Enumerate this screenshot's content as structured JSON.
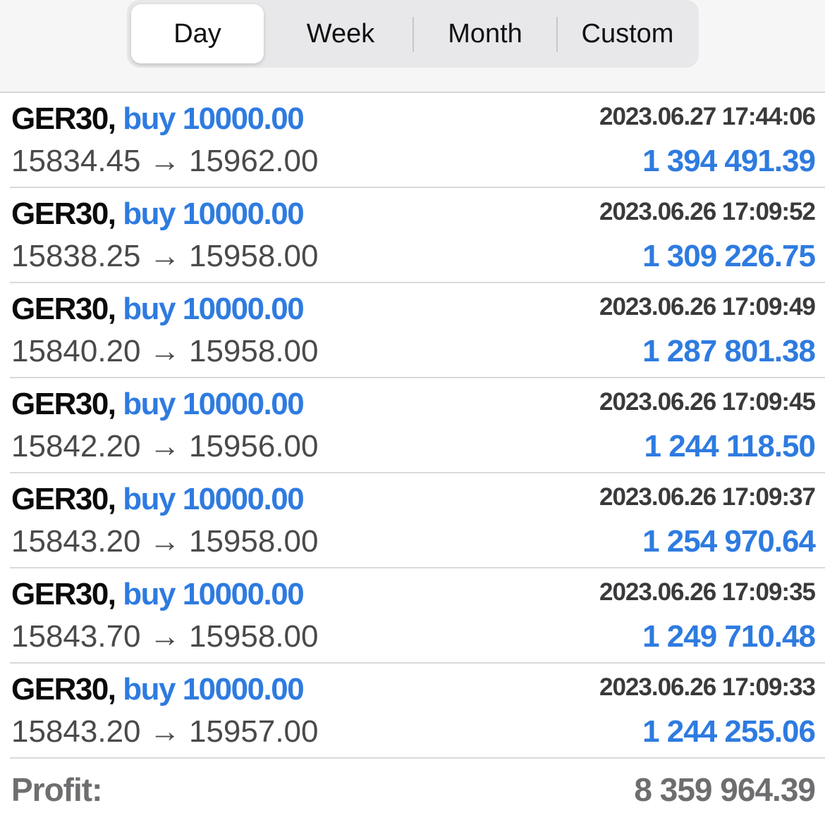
{
  "tabs": [
    {
      "label": "Day",
      "active": true
    },
    {
      "label": "Week",
      "active": false
    },
    {
      "label": "Month",
      "active": false
    },
    {
      "label": "Custom",
      "active": false
    }
  ],
  "deals": [
    {
      "symbol": "GER30,",
      "side": "buy 10000.00",
      "time": "2023.06.27 17:44:06",
      "prices": "15834.45 → 15962.00",
      "profit": "1 394 491.39"
    },
    {
      "symbol": "GER30,",
      "side": "buy 10000.00",
      "time": "2023.06.26 17:09:52",
      "prices": "15838.25 → 15958.00",
      "profit": "1 309 226.75"
    },
    {
      "symbol": "GER30,",
      "side": "buy 10000.00",
      "time": "2023.06.26 17:09:49",
      "prices": "15840.20 → 15958.00",
      "profit": "1 287 801.38"
    },
    {
      "symbol": "GER30,",
      "side": "buy 10000.00",
      "time": "2023.06.26 17:09:45",
      "prices": "15842.20 → 15956.00",
      "profit": "1 244 118.50"
    },
    {
      "symbol": "GER30,",
      "side": "buy 10000.00",
      "time": "2023.06.26 17:09:37",
      "prices": "15843.20 → 15958.00",
      "profit": "1 254 970.64"
    },
    {
      "symbol": "GER30,",
      "side": "buy 10000.00",
      "time": "2023.06.26 17:09:35",
      "prices": "15843.70 → 15958.00",
      "profit": "1 249 710.48"
    },
    {
      "symbol": "GER30,",
      "side": "buy 10000.00",
      "time": "2023.06.26 17:09:33",
      "prices": "15843.20 → 15957.00",
      "profit": "1 244 255.06"
    }
  ],
  "footer": {
    "label": "Profit:",
    "value": "8 359 964.39"
  },
  "colors": {
    "accent": "#2e7be0",
    "text": "#0b0b0b",
    "muted": "#6e6e70"
  }
}
